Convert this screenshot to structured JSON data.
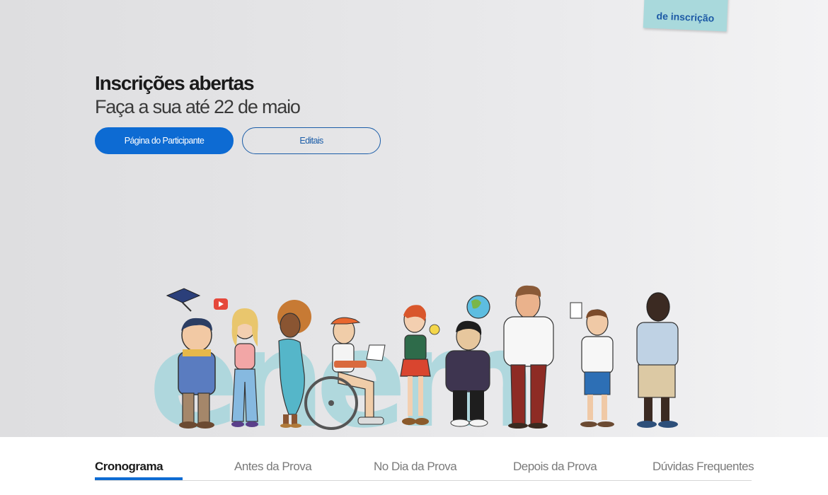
{
  "sticky_note": {
    "label": "de inscrição"
  },
  "hero": {
    "title": "Inscrições abertas",
    "subtitle": "Faça a sua até 22 de maio",
    "primary_button": "Página do Participante",
    "secondary_button": "Editais"
  },
  "illustration": {
    "word": "enem"
  },
  "tabs": [
    {
      "label": "Cronograma",
      "active": true
    },
    {
      "label": "Antes da Prova",
      "active": false
    },
    {
      "label": "No Dia da Prova",
      "active": false
    },
    {
      "label": "Depois da Prova",
      "active": false
    },
    {
      "label": "Dúvidas Frequentes",
      "active": false
    }
  ],
  "colors": {
    "accent": "#0d6bd3",
    "outline": "#1b5da8",
    "sticky": "#a9d9dc",
    "letters": "#a7d6dc"
  }
}
